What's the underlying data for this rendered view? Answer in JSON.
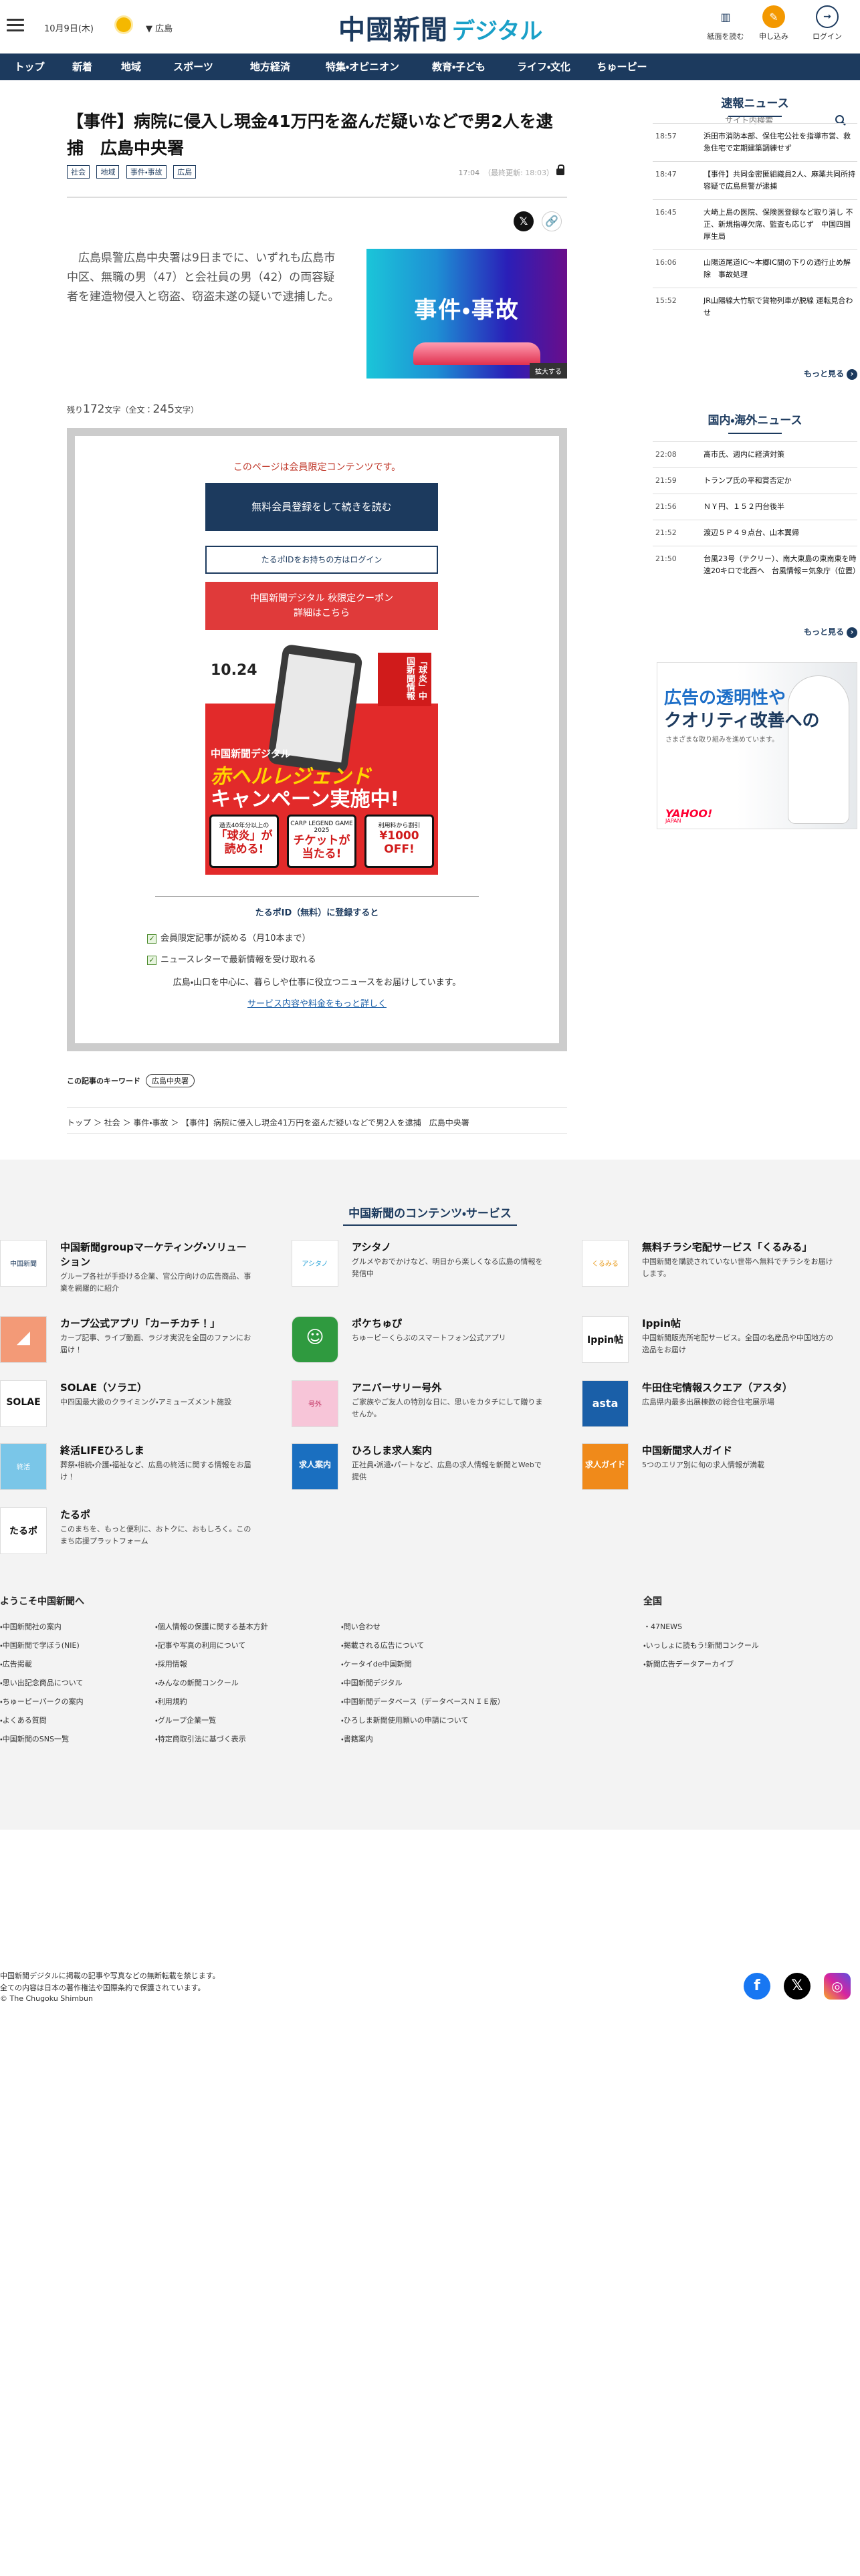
{
  "header": {
    "date": "10月9日(木)",
    "weather_icon": "sun-icon",
    "region": "広島",
    "logo_main": "中國新聞",
    "logo_sub": "デジタル",
    "buttons": [
      {
        "label": "紙面を読む",
        "icon": "newspaper-icon"
      },
      {
        "label": "申し込み",
        "icon": "signup-icon"
      },
      {
        "label": "ログイン",
        "icon": "login-icon"
      }
    ]
  },
  "nav": {
    "items": [
      "トップ",
      "新着",
      "地域",
      "スポーツ",
      "地方経済",
      "特集・オピニオン",
      "教育・子ども",
      "ライフ・文化",
      "ちゅーピー"
    ],
    "search_placeholder": "サイト内検索"
  },
  "article": {
    "title": "【事件】病院に侵入し現金41万円を盗んだ疑いなどで男2人を逮捕　広島中央署",
    "tags": [
      "社会",
      "地域",
      "事件・事故",
      "広島"
    ],
    "time": "17:04",
    "updated": "（最終更新: 18:03）",
    "lead": "広島県警広島中央署は9日までに、いずれも広島市中区、無職の男（47）と会社員の男（42）の両容疑者を建造物侵入と窃盗、窃盗未遂の疑いで逮捕した。",
    "photo_caption": "事件・事故",
    "enlarge_label": "拡大する",
    "remain_prefix": "残り",
    "remain_count": "172",
    "remain_suffix": "文字（全文：",
    "total_count": "245",
    "total_suffix": "文字）"
  },
  "paywall": {
    "members_only": "このページは会員限定コンテンツです。",
    "register_button": "無料会員登録をして続きを読む",
    "login_button": "たるポIDをお持ちの方はログイン",
    "coupon_line1": "中国新聞デジタル 秋限定クーポン",
    "coupon_line2": "詳細はこちら",
    "banner": {
      "date": "10.24",
      "badge": "「球炎」中国新聞情報",
      "line1": "中国新聞デジタル",
      "line2": "赤ヘルレジェンド",
      "line3": "キャンペーン実施中!",
      "cards": [
        {
          "small": "過去40年分以上の",
          "large": "「球炎」が読める!"
        },
        {
          "small": "CARP LEGEND GAME 2025",
          "large": "チケットが当たる!"
        },
        {
          "small": "利用料から割引",
          "large": "¥1000 OFF!"
        }
      ]
    },
    "benefits_title": "たるポID（無料）に登録すると",
    "benefits": [
      "会員限定記事が読める（月10本まで）",
      "ニュースレターで最新情報を受け取れる"
    ],
    "info": "広島・山口を中心に、暮らしや仕事に役立つニュースをお届けしています。",
    "more_link": "サービス内容や料金をもっと詳しく"
  },
  "keywords": {
    "label": "この記事のキーワード",
    "items": [
      "広島中央署"
    ]
  },
  "breadcrumb": [
    "トップ",
    "社会",
    "事件・事故",
    "【事件】病院に侵入し現金41万円を盗んだ疑いなどで男2人を逮捕　広島中央署"
  ],
  "sidebar": {
    "breaking_title": "速報ニュース",
    "breaking": [
      {
        "time": "18:57",
        "text": "浜田市消防本部、保住宅公社を指導市営、救急住宅で定期建築調練せず"
      },
      {
        "time": "18:47",
        "text": "【事件】共同金密匿組織員2人、麻薬共同所持容疑で広島県警が逮捕"
      },
      {
        "time": "16:45",
        "text": "大崎上島の医院、保険医登録など取り消し 不正、新規指導欠席、監査も応じず　中国四国厚生局"
      },
      {
        "time": "16:06",
        "text": "山陽道尾道IC～本郷IC間の下りの通行止め解除　事故処理"
      },
      {
        "time": "15:52",
        "text": "JR山陽線大竹駅で貨物列車が脱線 運転見合わせ"
      }
    ],
    "more": "もっと見る",
    "domestic_title": "国内・海外ニュース",
    "domestic": [
      {
        "time": "22:08",
        "text": "高市氏、週内に経済対策"
      },
      {
        "time": "21:59",
        "text": "トランプ氏の平和賞否定か"
      },
      {
        "time": "21:56",
        "text": "ＮＹ円、１５２円台後半"
      },
      {
        "time": "21:52",
        "text": "渡辺５Ｐ４９点台、山本翼帰"
      },
      {
        "time": "21:50",
        "text": "台風23号（テクリー）、南大東島の東南東を時速20キロで北西へ　台風情報＝気象庁（位置）"
      }
    ],
    "ad": {
      "line1": "広告の透明性や",
      "line2": "クオリティ改善への",
      "line3": "さまざまな取り組みを進めています。",
      "brand": "YAHOO!",
      "brand_sub": "JAPAN"
    }
  },
  "footer": {
    "services_title": "中国新聞のコンテンツ・サービス",
    "services": [
      {
        "name": "中国新聞groupマーケティング・ソリューション",
        "desc": "グループ各社が手掛ける企業、官公庁向けの広告商品、事業を網羅的に紹介",
        "icon": "marketing-logo"
      },
      {
        "name": "アシタノ",
        "desc": "グルメやおでかけなど、明日から楽しくなる広島の情報を発信中",
        "icon": "ashitano-logo"
      },
      {
        "name": "無料チラシ宅配サービス「くるみる」",
        "desc": "中国新聞を購読されていない世帯へ無料でチラシをお届けします。",
        "icon": "kurumiru-logo"
      },
      {
        "name": "カープ公式アプリ「カーチカチ！」",
        "desc": "カープ記事、ライブ動画、ラジオ実況を全国のファンにお届け！",
        "icon": "carp-app-logo"
      },
      {
        "name": "ポケちゅぴ",
        "desc": "ちゅーピーくらぶのスマートフォン公式アプリ",
        "icon": "pokechupi-logo"
      },
      {
        "name": "Ippin帖",
        "desc": "中国新聞販売所宅配サービス。全国の名産品や中国地方の逸品をお届け",
        "icon": "ippin-logo"
      },
      {
        "name": "SOLAE（ソラエ）",
        "desc": "中四国最大級のクライミング・アミューズメント施設",
        "icon": "solae-logo"
      },
      {
        "name": "アニバーサリー号外",
        "desc": "ご家族やご友人の特別な日に、思いをカタチにして贈りませんか。",
        "icon": "anniversary-logo"
      },
      {
        "name": "牛田住宅情報スクエア（アスタ）",
        "desc": "広島県内最多出展棟数の総合住宅展示場",
        "icon": "asta-logo"
      },
      {
        "name": "終活LIFEひろしま",
        "desc": "葬祭・相続・介護・福祉など、広島の終活に関する情報をお届け！",
        "icon": "shukatsu-logo"
      },
      {
        "name": "ひろしま求人案内",
        "desc": "正社員・派遣・パートなど、広島の求人情報を新聞とWebで提供",
        "icon": "kyujin-logo"
      },
      {
        "name": "中国新聞求人ガイド",
        "desc": "5つのエリア別に旬の求人情報が満載",
        "icon": "kyujin-guide-logo"
      },
      {
        "name": "たるポ",
        "desc": "このまちを、もっと便利に、おトクに、おもしろく。このまち応援プラットフォーム",
        "icon": "tarupo-logo"
      }
    ],
    "welcome_title": "ようこそ中国新聞へ",
    "col1": [
      "中国新聞社の案内",
      "中国新聞で学ぼう(NIE)",
      "広告掲載",
      "思い出記念商品について",
      "ちゅーピーパークの案内",
      "よくある質問",
      "中国新聞のSNS一覧"
    ],
    "col2": [
      "個人情報の保護に関する基本方針",
      "記事や写真の利用について",
      "採用情報",
      "みんなの新聞コンクール",
      "利用規約",
      "グループ企業一覧",
      "特定商取引法に基づく表示"
    ],
    "col3": [
      "問い合わせ",
      "掲載される広告について",
      "ケータイde中国新聞",
      "中国新聞デジタル",
      "中国新聞データベース（データベースＮＩＥ版）",
      "ひろしま新聞使用願いの申請について",
      "書籍案内"
    ],
    "national_title": "全国",
    "col4": [
      "47NEWS",
      "いっしょに読もう!新聞コンクール",
      "新聞広告データアーカイブ"
    ]
  },
  "copyright": {
    "line1": "中国新聞デジタルに掲載の記事や写真などの無断転載を禁じます。",
    "line2": "全ての内容は日本の著作権法や国際条約で保護されています。",
    "line3": "© The Chugoku Shimbun"
  },
  "social": [
    {
      "name": "Facebook",
      "icon": "facebook-icon",
      "color": "#1877f2"
    },
    {
      "name": "X",
      "icon": "x-icon",
      "color": "#000000"
    },
    {
      "name": "Instagram",
      "icon": "instagram-icon",
      "color": "#d6249f"
    }
  ]
}
